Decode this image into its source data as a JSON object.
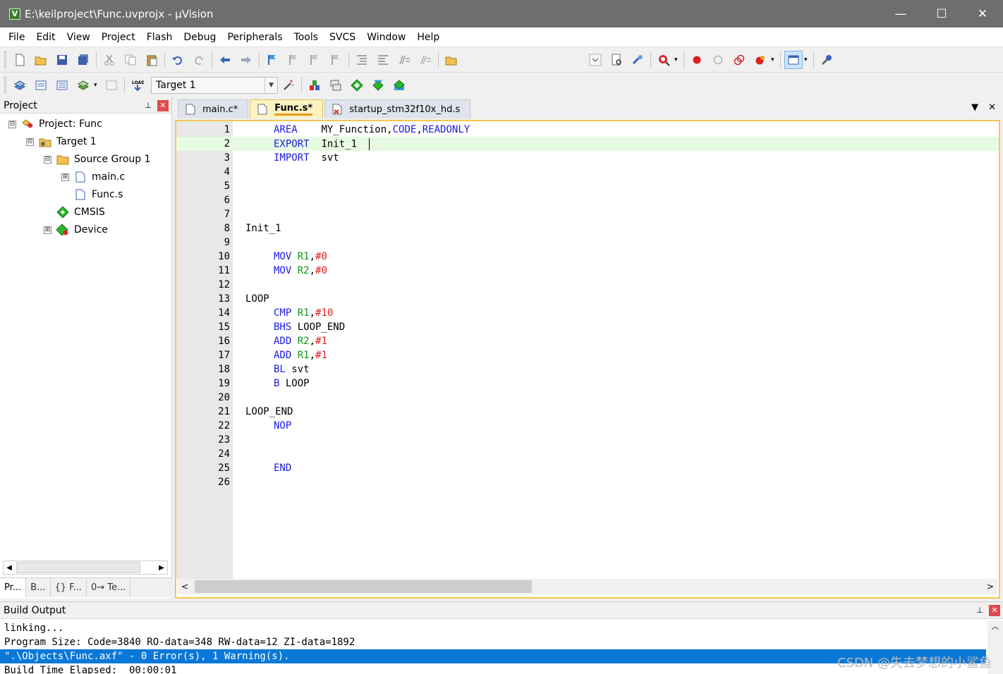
{
  "window": {
    "title": "E:\\keilproject\\Func.uvprojx - µVision",
    "app_icon": "V",
    "minimize": "—",
    "maximize": "☐",
    "close": "✕"
  },
  "menu": [
    "File",
    "Edit",
    "View",
    "Project",
    "Flash",
    "Debug",
    "Peripherals",
    "Tools",
    "SVCS",
    "Window",
    "Help"
  ],
  "toolbar": {
    "target": "Target 1"
  },
  "project_panel": {
    "title": "Project",
    "pin": "⊥",
    "close": "✕",
    "tree": [
      {
        "label": "Project: Func",
        "expander": "⊟",
        "icon": "project-icon"
      },
      {
        "label": "Target 1",
        "expander": "⊟",
        "icon": "target-folder-icon"
      },
      {
        "label": "Source Group 1",
        "expander": "⊟",
        "icon": "folder-icon"
      },
      {
        "label": "main.c",
        "expander": "⊞",
        "icon": "file-icon"
      },
      {
        "label": "Func.s",
        "expander": "",
        "icon": "file-icon"
      },
      {
        "label": "CMSIS",
        "expander": "",
        "icon": "cmsis-diamond-icon"
      },
      {
        "label": "Device",
        "expander": "⊞",
        "icon": "device-diamond-icon"
      }
    ],
    "tabs": [
      "Pr...",
      "B...",
      "{} F...",
      "0→ Te..."
    ]
  },
  "editor": {
    "tabs": [
      {
        "label": "main.c*",
        "active": false
      },
      {
        "label": "Func.s*",
        "active": true
      },
      {
        "label": "startup_stm32f10x_hd.s",
        "active": false
      }
    ],
    "tab_menu": "▼",
    "tab_close": "✕",
    "current_line": 2,
    "lines": [
      {
        "num": "1",
        "instr": "AREA",
        "rest": "MY_Function,CODE,READONLY",
        "label": ""
      },
      {
        "num": "2",
        "instr": "EXPORT",
        "rest": "Init_1",
        "label": ""
      },
      {
        "num": "3",
        "instr": "IMPORT",
        "rest": "svt",
        "label": ""
      },
      {
        "num": "4"
      },
      {
        "num": "5"
      },
      {
        "num": "6"
      },
      {
        "num": "7"
      },
      {
        "num": "8",
        "label": "Init_1"
      },
      {
        "num": "9"
      },
      {
        "num": "10",
        "instr": "MOV",
        "reg": "R1",
        "imm": "#0"
      },
      {
        "num": "11",
        "instr": "MOV",
        "reg": "R2",
        "imm": "#0"
      },
      {
        "num": "12"
      },
      {
        "num": "13",
        "label": "LOOP"
      },
      {
        "num": "14",
        "instr": "CMP",
        "reg": "R1",
        "imm": "#10"
      },
      {
        "num": "15",
        "instr": "BHS",
        "rest": "LOOP_END"
      },
      {
        "num": "16",
        "instr": "ADD",
        "reg": "R2",
        "imm": "#1"
      },
      {
        "num": "17",
        "instr": "ADD",
        "reg": "R1",
        "imm": "#1"
      },
      {
        "num": "18",
        "instr": "BL",
        "rest": "svt"
      },
      {
        "num": "19",
        "instr": "B",
        "rest": "LOOP"
      },
      {
        "num": "20"
      },
      {
        "num": "21",
        "label": "LOOP_END"
      },
      {
        "num": "22",
        "instr": "NOP"
      },
      {
        "num": "23"
      },
      {
        "num": "24"
      },
      {
        "num": "25",
        "instr": "END"
      },
      {
        "num": "26"
      }
    ]
  },
  "build_output": {
    "title": "Build Output",
    "lines": [
      "linking...",
      "Program Size: Code=3840 RO-data=348 RW-data=12 ZI-data=1892",
      "\".\\Objects\\Func.axf\" - 0 Error(s), 1 Warning(s).",
      "Build Time Elapsed:  00:00:01"
    ],
    "selected_line": 2
  },
  "watermark": "CSDN @失去梦想的小鲨鱼"
}
